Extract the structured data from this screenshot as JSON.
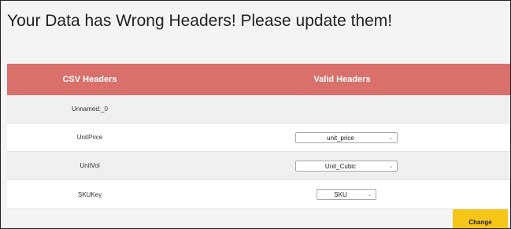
{
  "page": {
    "title": "Your Data has Wrong Headers! Please update them!"
  },
  "table": {
    "columns": {
      "csv": "CSV Headers",
      "valid": "Valid Headers"
    },
    "rows": [
      {
        "csv_header": "Unnamed:_0",
        "valid_header": ""
      },
      {
        "csv_header": "UnitPrice",
        "valid_header": "unit_price"
      },
      {
        "csv_header": "UnitVol",
        "valid_header": "Unit_Cubic"
      },
      {
        "csv_header": "SKUKey",
        "valid_header": "SKU"
      }
    ]
  },
  "actions": {
    "change_label": "Change"
  },
  "colors": {
    "header_bg": "#d9706b",
    "button_bg": "#f5c518"
  },
  "icons": {
    "dropdown": "chevron-down-icon"
  }
}
